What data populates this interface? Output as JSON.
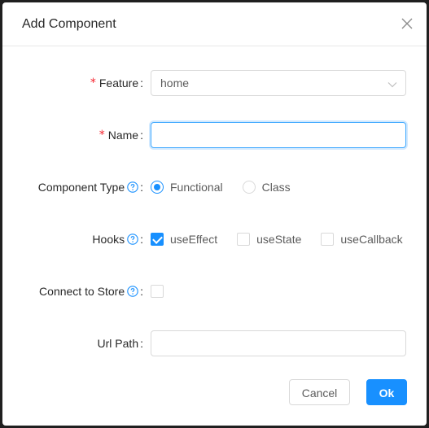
{
  "modal": {
    "title": "Add Component",
    "close_icon": "close-icon"
  },
  "form": {
    "feature": {
      "label": "Feature",
      "required": true,
      "value": "home",
      "arrow_icon": "chevron-down-icon"
    },
    "name": {
      "label": "Name",
      "required": true,
      "value": "",
      "placeholder": ""
    },
    "component_type": {
      "label": "Component Type",
      "help_icon": "question-circle-icon",
      "options": [
        "Functional",
        "Class"
      ],
      "selected": "Functional"
    },
    "hooks": {
      "label": "Hooks",
      "help_icon": "question-circle-icon",
      "options": [
        {
          "label": "useEffect",
          "checked": true
        },
        {
          "label": "useState",
          "checked": false
        },
        {
          "label": "useCallback",
          "checked": false
        }
      ]
    },
    "connect_to_store": {
      "label": "Connect to Store",
      "help_icon": "question-circle-icon",
      "checked": false
    },
    "url_path": {
      "label": "Url Path",
      "value": "",
      "placeholder": ""
    },
    "colon": ":"
  },
  "footer": {
    "cancel_label": "Cancel",
    "ok_label": "Ok"
  },
  "colors": {
    "primary": "#1890ff",
    "required": "#f5222d",
    "border": "#d9d9d9",
    "focus_border": "#40a9ff"
  }
}
